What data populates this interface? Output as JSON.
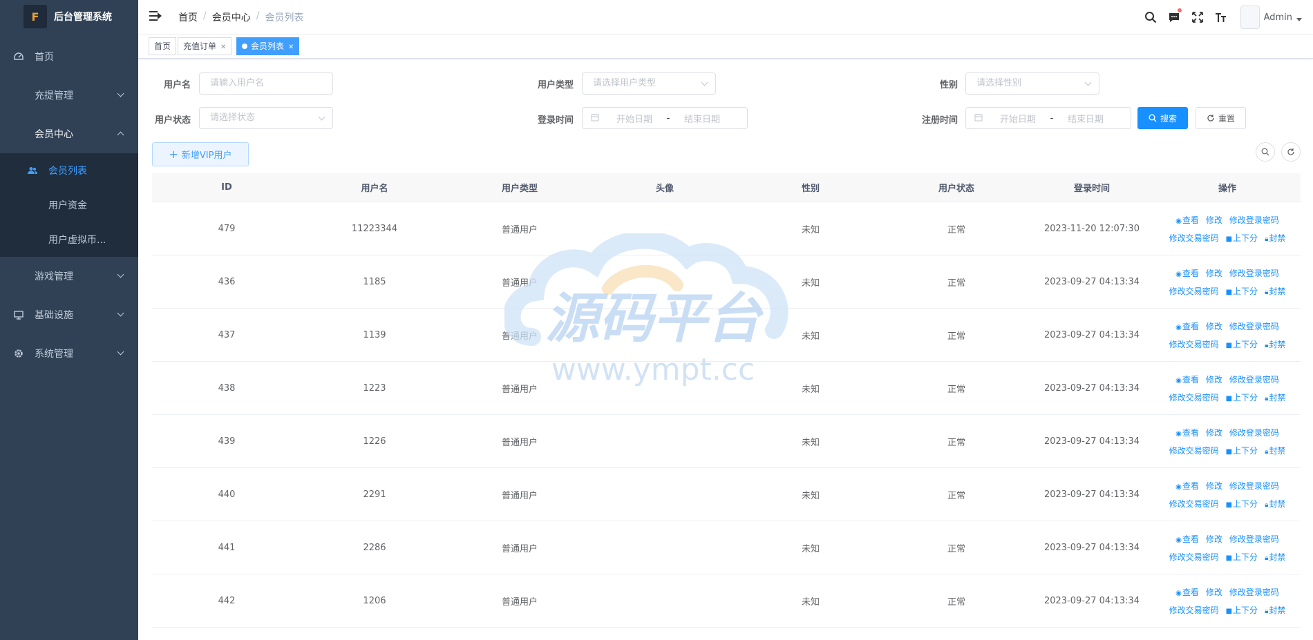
{
  "app": {
    "title": "后台管理系统",
    "logo_text": "F"
  },
  "sidebar": {
    "items": [
      {
        "label": "首页",
        "icon": "dashboard-icon"
      },
      {
        "label": "充提管理"
      },
      {
        "label": "会员中心"
      },
      {
        "label": "游戏管理"
      },
      {
        "label": "基础设施",
        "icon": "monitor-icon"
      },
      {
        "label": "系统管理",
        "icon": "gear-icon"
      }
    ],
    "sub_items": [
      {
        "label": "会员列表",
        "icon": "users-icon"
      },
      {
        "label": "用户资金"
      },
      {
        "label": "用户虚拟币..."
      }
    ]
  },
  "breadcrumb": [
    "首页",
    "会员中心",
    "会员列表"
  ],
  "navbar": {
    "admin_name": "Admin"
  },
  "tags": [
    {
      "label": "首页"
    },
    {
      "label": "充值订单"
    },
    {
      "label": "会员列表"
    }
  ],
  "search": {
    "username_label": "用户名",
    "username_placeholder": "请输入用户名",
    "usertype_label": "用户类型",
    "usertype_placeholder": "请选择用户类型",
    "sex_label": "性别",
    "sex_placeholder": "请选择性别",
    "status_label": "用户状态",
    "status_placeholder": "请选择状态",
    "login_label": "登录时间",
    "register_label": "注册时间",
    "start_placeholder": "开始日期",
    "end_placeholder": "结束日期",
    "dash": "-",
    "search_btn": "搜索",
    "reset_btn": "重置"
  },
  "toolbar": {
    "add_vip": "新增VIP用户"
  },
  "table": {
    "headers": [
      "ID",
      "用户名",
      "用户类型",
      "头像",
      "性别",
      "用户状态",
      "登录时间",
      "操作"
    ],
    "rows": [
      {
        "id": "479",
        "name": "11223344",
        "type": "普通用户",
        "sex": "未知",
        "status": "正常",
        "login": "2023-11-20 12:07:30"
      },
      {
        "id": "436",
        "name": "1185",
        "type": "普通用户",
        "sex": "未知",
        "status": "正常",
        "login": "2023-09-27 04:13:34"
      },
      {
        "id": "437",
        "name": "1139",
        "type": "普通用户",
        "sex": "未知",
        "status": "正常",
        "login": "2023-09-27 04:13:34"
      },
      {
        "id": "438",
        "name": "1223",
        "type": "普通用户",
        "sex": "未知",
        "status": "正常",
        "login": "2023-09-27 04:13:34"
      },
      {
        "id": "439",
        "name": "1226",
        "type": "普通用户",
        "sex": "未知",
        "status": "正常",
        "login": "2023-09-27 04:13:34"
      },
      {
        "id": "440",
        "name": "2291",
        "type": "普通用户",
        "sex": "未知",
        "status": "正常",
        "login": "2023-09-27 04:13:34"
      },
      {
        "id": "441",
        "name": "2286",
        "type": "普通用户",
        "sex": "未知",
        "status": "正常",
        "login": "2023-09-27 04:13:34"
      },
      {
        "id": "442",
        "name": "1206",
        "type": "普通用户",
        "sex": "未知",
        "status": "正常",
        "login": "2023-09-27 04:13:34"
      }
    ],
    "ops": {
      "view": "查看",
      "edit": "修改",
      "edit_login_pwd": "修改登录密码",
      "edit_trade_pwd": "修改交易密码",
      "updown": "上下分",
      "ban": "封禁"
    }
  },
  "watermark": {
    "title": "源码平台",
    "url": "www.ympt.cc"
  }
}
